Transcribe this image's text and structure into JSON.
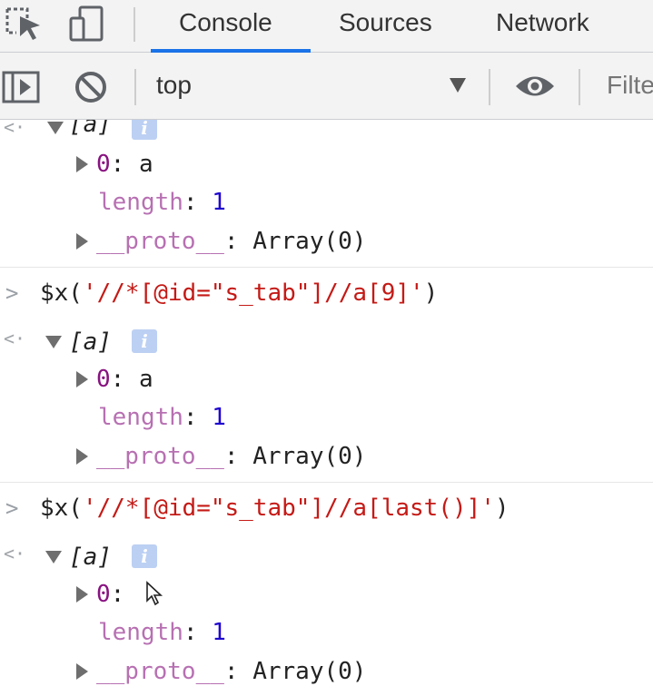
{
  "tabs": [
    {
      "label": "Console",
      "active": true
    },
    {
      "label": "Sources",
      "active": false
    },
    {
      "label": "Network",
      "active": false
    }
  ],
  "toolbar": {
    "context": "top",
    "filter_placeholder": "Filte"
  },
  "console": {
    "partial_group": {
      "label": "[a]",
      "item0_key": "0",
      "item0_value": "a",
      "length_key": "length",
      "length_value": "1",
      "proto_key": "__proto__",
      "proto_value": "Array(0)"
    },
    "entries": [
      {
        "command_prefix": "$x(",
        "command_string": "'//*[@id=\"s_tab\"]//a[9]'",
        "command_suffix": ")",
        "result_label": "[a]",
        "item0_key": "0",
        "item0_value": "a",
        "length_key": "length",
        "length_value": "1",
        "proto_key": "__proto__",
        "proto_value": "Array(0)"
      },
      {
        "command_prefix": "$x(",
        "command_string": "'//*[@id=\"s_tab\"]//a[last()]'",
        "command_suffix": ")",
        "result_label": "[a]",
        "item0_key": "0",
        "item0_value": "",
        "length_key": "length",
        "length_value": "1",
        "proto_key": "__proto__",
        "proto_value": "Array(0)"
      }
    ],
    "info_badge": "i",
    "prompt_glyph": ">",
    "result_glyph": "<·"
  },
  "colors": {
    "accent": "#1a73e8",
    "key": "#881280",
    "number": "#1c00cf",
    "string": "#c41a16"
  },
  "icons": [
    "inspect-element-icon",
    "device-toolbar-icon",
    "sidebar-toggle-icon",
    "clear-console-icon",
    "live-expression-eye-icon",
    "mouse-cursor-icon"
  ]
}
